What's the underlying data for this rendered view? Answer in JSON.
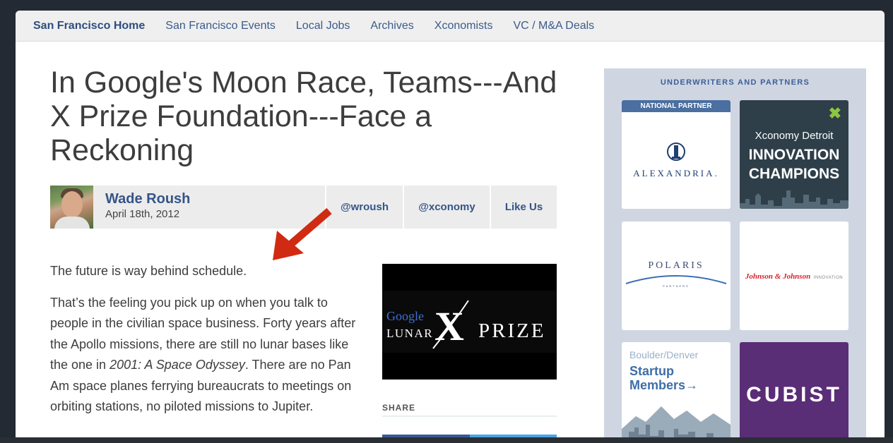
{
  "nav": {
    "items": [
      {
        "label": "San Francisco Home",
        "active": true
      },
      {
        "label": "San Francisco Events"
      },
      {
        "label": "Local Jobs"
      },
      {
        "label": "Archives"
      },
      {
        "label": "Xconomists"
      },
      {
        "label": "VC / M&A Deals"
      }
    ]
  },
  "article": {
    "title": "In Google's Moon Race, Teams---And X Prize Foundation---Face a Reckoning",
    "author": "Wade Roush",
    "date": "April 18th, 2012",
    "social": {
      "twitter_author": "@wroush",
      "twitter_site": "@xconomy",
      "like": "Like Us"
    },
    "paragraph1": "The future is way behind schedule.",
    "paragraph2_part1": "That’s the feeling you pick up on when you talk to people in the civilian space business. Forty years after the Apollo missions, there are still no lunar bases like the one in ",
    "paragraph2_italic": "2001: A Space Odyssey",
    "paragraph2_part2": ". There are no Pan Am space planes ferrying bureaucrats to meetings on orbiting stations, no piloted missions to Jupiter."
  },
  "image": {
    "line1": "Google",
    "line2": "LUNAR",
    "x": "X",
    "prize": "PRIZE"
  },
  "share": {
    "label": "SHARE"
  },
  "sidebar": {
    "title": "UNDERWRITERS AND PARTNERS",
    "national_partner": "NATIONAL PARTNER",
    "alexandria": "ALEXANDRIA.",
    "detroit_line1": "Xconomy Detroit",
    "detroit_line2": "INNOVATION",
    "detroit_line3": "CHAMPIONS",
    "polaris": "POLARIS",
    "polaris_sub": "PARTNERS",
    "jj_brand": "Johnson & Johnson",
    "jj_innovation": "INNOVATION",
    "boulder_top": "Boulder/Denver",
    "boulder_line1": "Startup",
    "boulder_line2": "Members→",
    "cubist": "CUBIST"
  },
  "colors": {
    "accent": "#355488",
    "arrow": "#d12a12",
    "sidebar_bg": "#cfd6e2"
  }
}
